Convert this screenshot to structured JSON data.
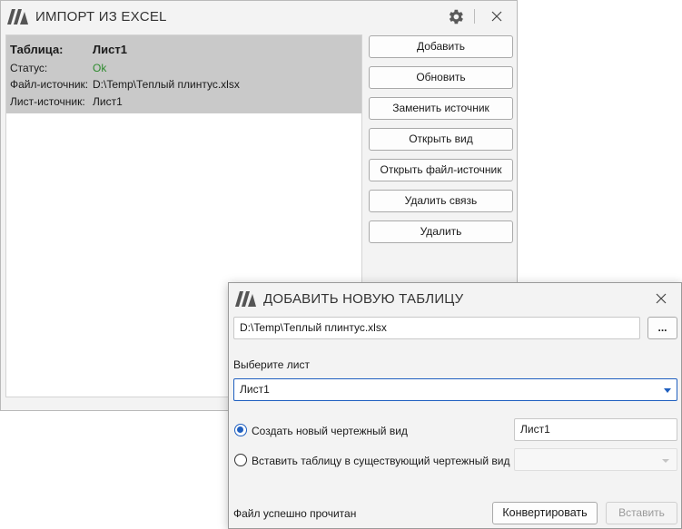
{
  "main_window": {
    "title": "ИМПОРТ ИЗ EXCEL",
    "table_item": {
      "table_label": "Таблица:",
      "table_value": "Лист1",
      "status_label": "Статус:",
      "status_value": "Ok",
      "source_file_label": "Файл-источник:",
      "source_file_value": "D:\\Temp\\Теплый плинтус.xlsx",
      "source_sheet_label": "Лист-источник:",
      "source_sheet_value": "Лист1"
    },
    "buttons": {
      "add": "Добавить",
      "refresh": "Обновить",
      "replace_source": "Заменить источник",
      "open_view": "Открыть вид",
      "open_source_file": "Открыть файл-источник",
      "remove_link": "Удалить связь",
      "delete": "Удалить"
    }
  },
  "dialog": {
    "title": "ДОБАВИТЬ НОВУЮ ТАБЛИЦУ",
    "file_path": "D:\\Temp\\Теплый плинтус.xlsx",
    "browse_label": "...",
    "sheet_label": "Выберите лист",
    "sheet_selected": "Лист1",
    "option_new_view": "Создать новый чертежный вид",
    "new_view_name": "Лист1",
    "option_existing_view": "Вставить таблицу в существующий чертежный вид",
    "existing_view_value": "",
    "status_text": "Файл успешно прочитан",
    "convert_label": "Конвертировать",
    "insert_label": "Вставить"
  },
  "colors": {
    "accent": "#1f5fbf",
    "status_ok": "#2e8b2e",
    "selected_row": "#c9c9c9"
  }
}
